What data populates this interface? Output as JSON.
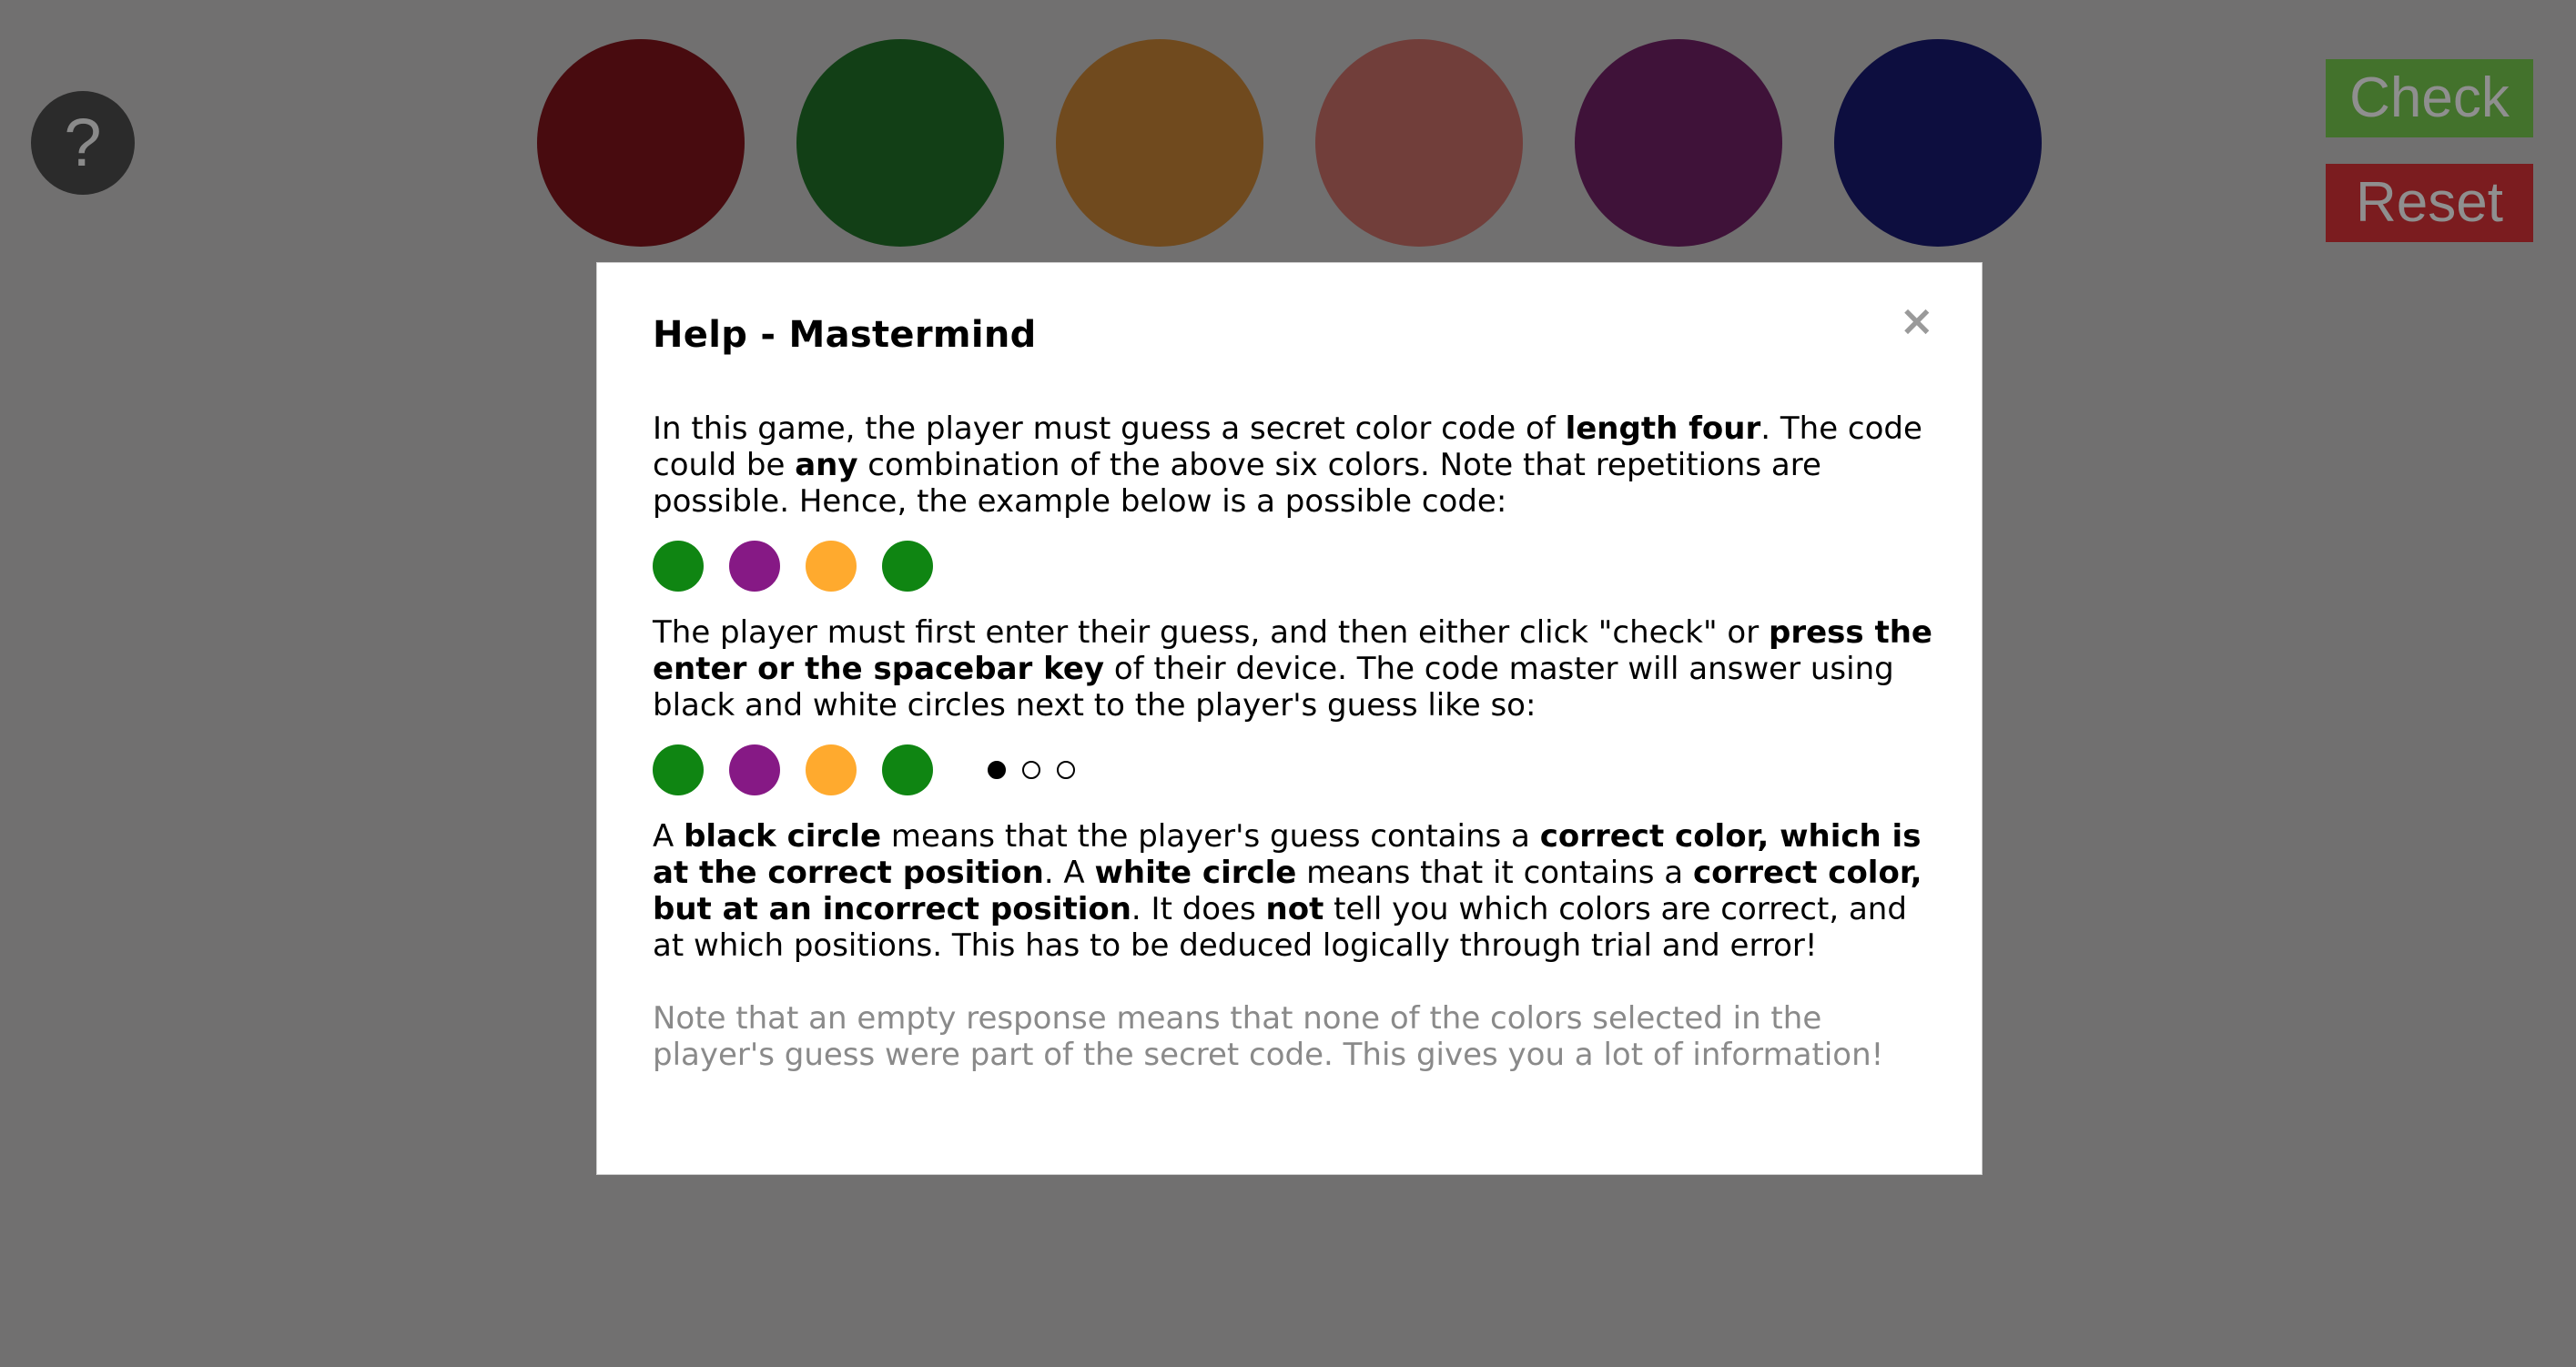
{
  "help_button": {
    "label": "?"
  },
  "palette": [
    {
      "name": "red",
      "color": "#480b0f"
    },
    {
      "name": "green",
      "color": "#123f16"
    },
    {
      "name": "orange",
      "color": "#704a1e"
    },
    {
      "name": "pink",
      "color": "#713e3a"
    },
    {
      "name": "purple",
      "color": "#3f1239"
    },
    {
      "name": "blue",
      "color": "#0d0e3f"
    }
  ],
  "actions": {
    "check_label": "Check",
    "reset_label": "Reset"
  },
  "modal": {
    "close_label": "×",
    "title": "Help - Mastermind",
    "p1": {
      "t1": "In this game, the player must guess a secret color code of ",
      "b1": "length four",
      "t2": ". The code could be ",
      "b2": "any",
      "t3": " combination of the above six colors. Note that repetitions are possible. Hence, the example below is a possible code:"
    },
    "example_code": [
      "#0f8512",
      "#861985",
      "#ffaa2e",
      "#0f8512"
    ],
    "p2": {
      "t1": "The player must first enter their guess, and then either click \"check\" or ",
      "b1": "press the enter or the spacebar key",
      "t2": " of their device. The code master will answer using black and white circles next to the player's guess like so:"
    },
    "example_guess": [
      "#0f8512",
      "#861985",
      "#ffaa2e",
      "#0f8512"
    ],
    "example_feedback": [
      "black",
      "white",
      "white"
    ],
    "p3": {
      "t1": "A ",
      "b1": "black circle",
      "t2": " means that the player's guess contains a ",
      "b2": "correct color, which is at the correct position",
      "t3": ". A ",
      "b3": "white circle",
      "t4": " means that it contains a ",
      "b4": "correct color, but at an incorrect position",
      "t5": ". It does ",
      "b5": "not",
      "t6": " tell you which colors are correct, and at which positions. This has to be deduced logically through trial and error!"
    },
    "note": "Note that an empty response means that none of the colors selected in the player's guess were part of the secret code. This gives you a lot of information!"
  }
}
